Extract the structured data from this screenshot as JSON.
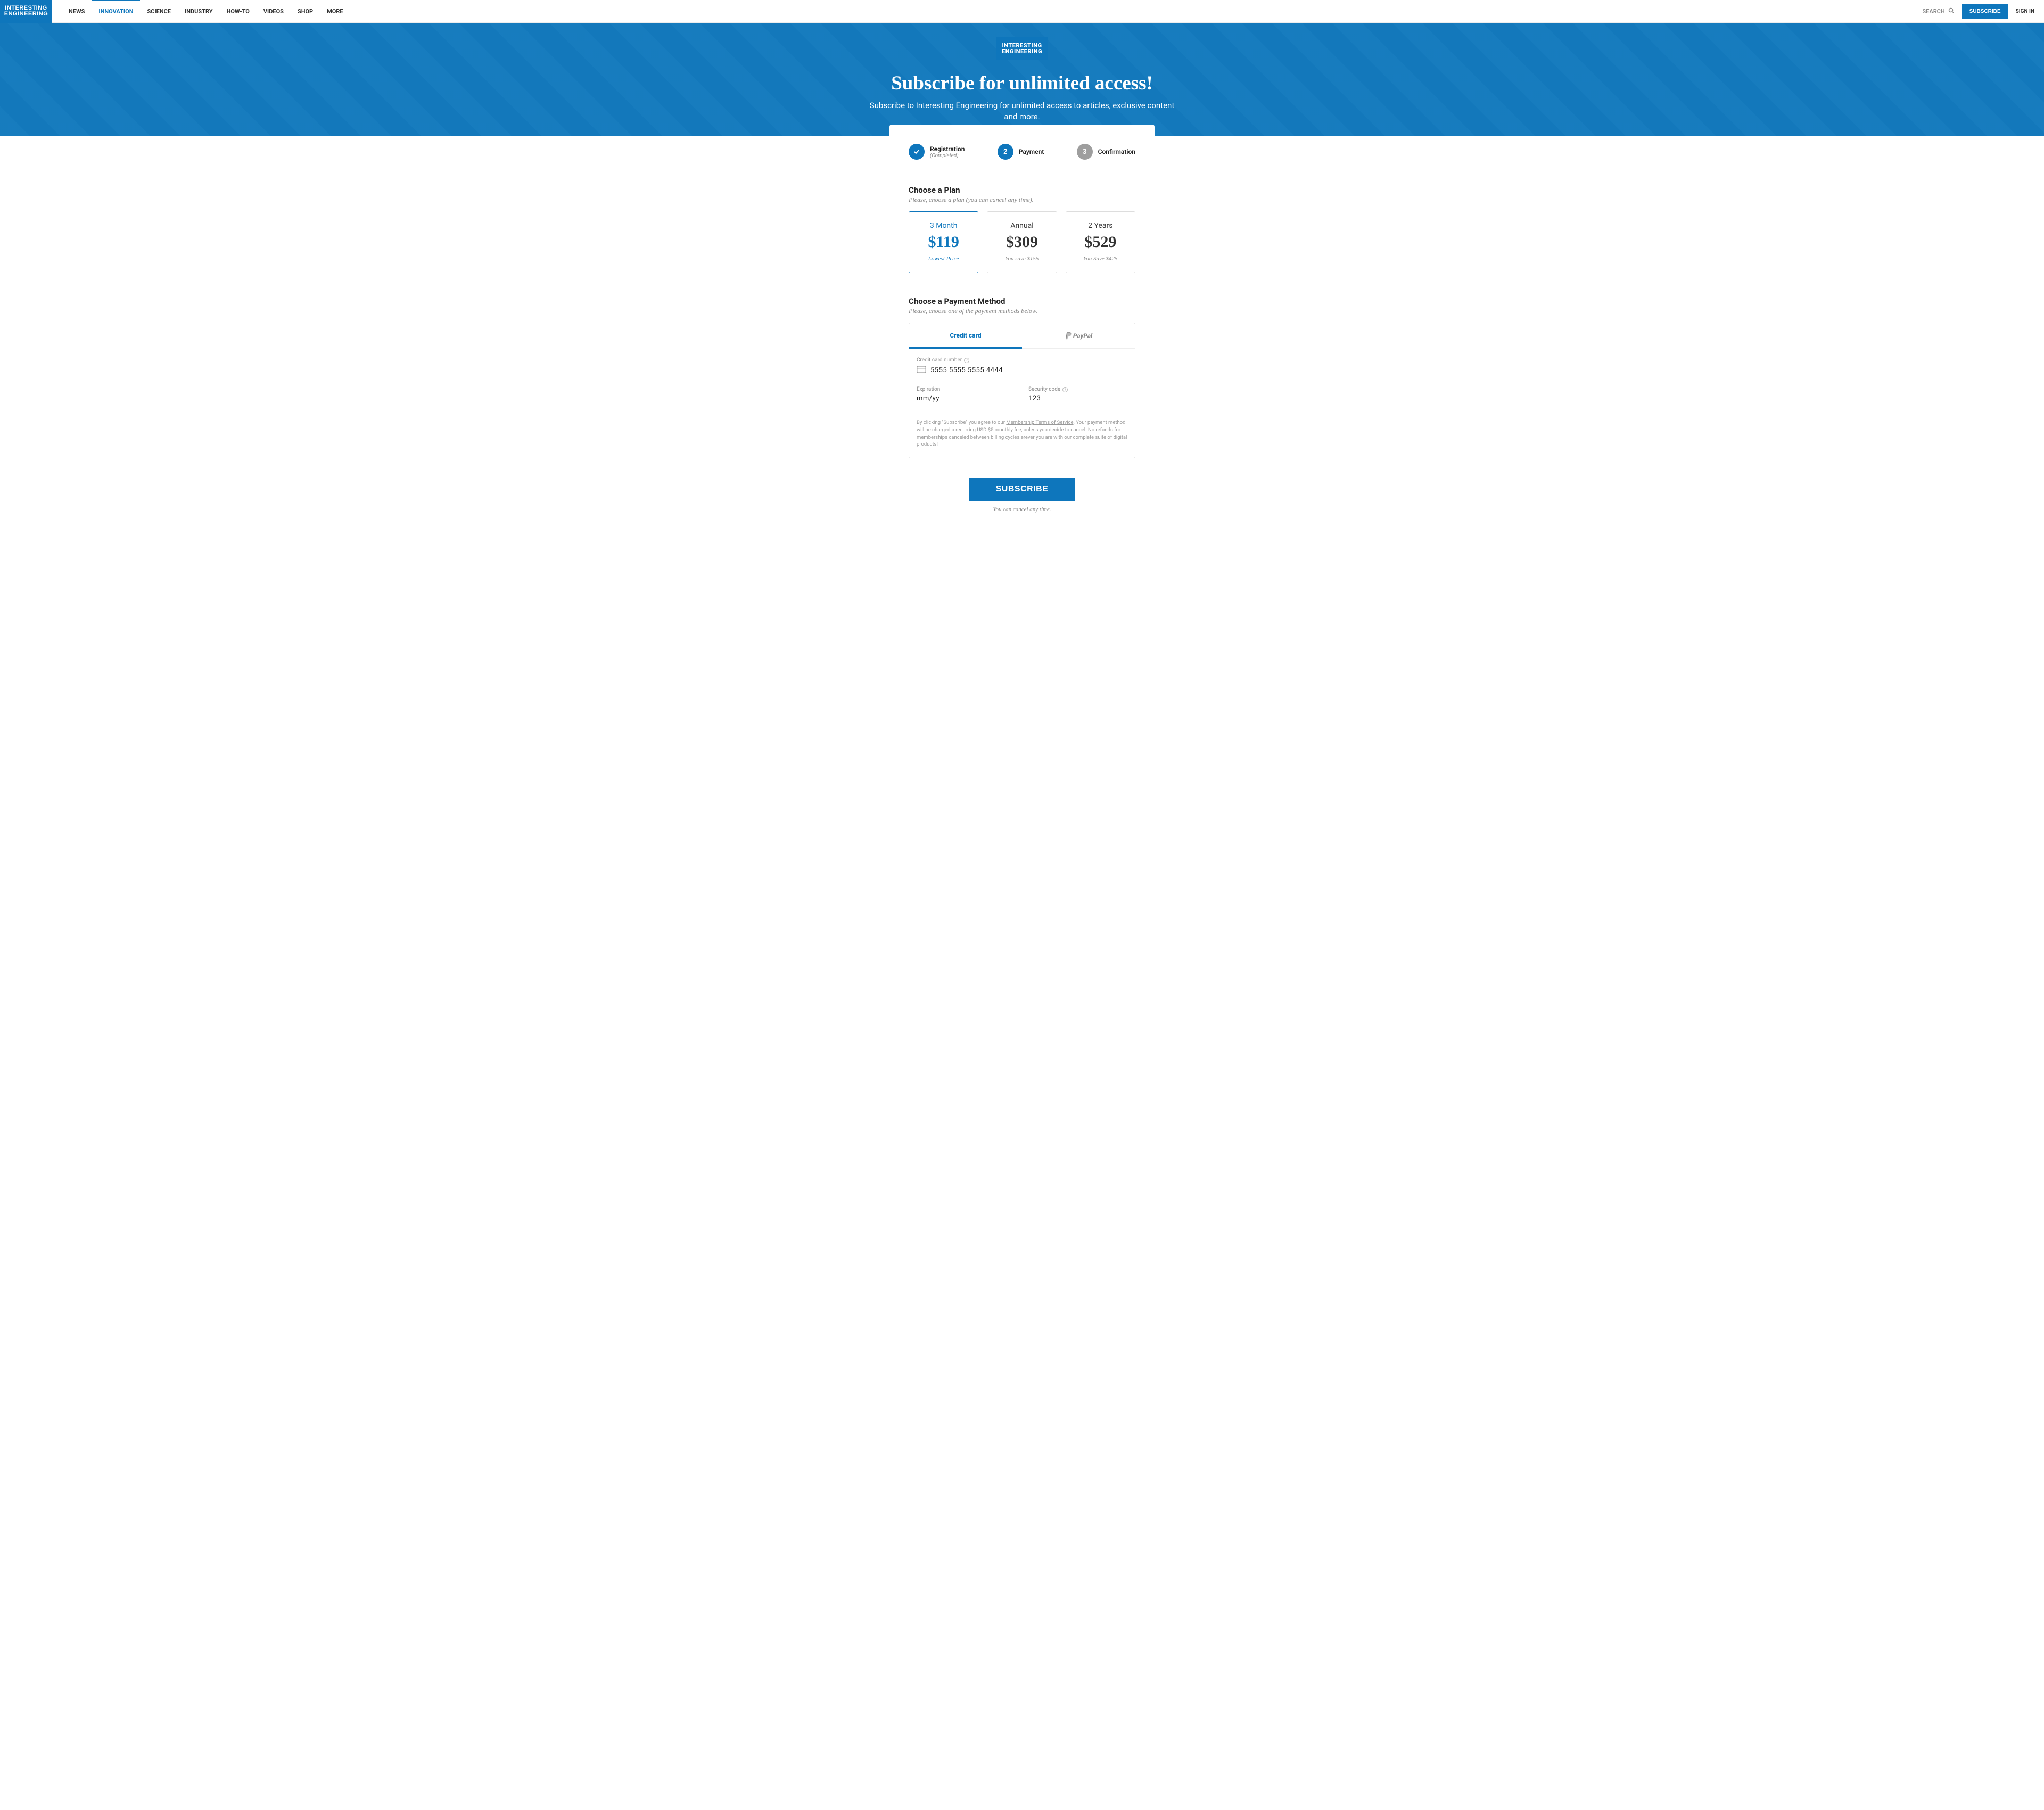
{
  "brand": {
    "line1": "INTERESTING",
    "line2": "ENGINEERING"
  },
  "nav": {
    "items": [
      "NEWS",
      "INNOVATION",
      "SCIENCE",
      "INDUSTRY",
      "HOW-TO",
      "VIDEOS",
      "SHOP",
      "MORE"
    ],
    "active_index": 1
  },
  "header": {
    "search_placeholder": "SEARCH",
    "subscribe": "SUBSCRIBE",
    "signin": "SIGN IN"
  },
  "hero": {
    "title": "Subscribe for unlimited access!",
    "subtitle": "Subscribe to Interesting Engineering for unlimited access to articles, exclusive content and more."
  },
  "stepper": {
    "steps": [
      {
        "label": "Registration",
        "sub": "(Completed)",
        "state": "done"
      },
      {
        "label": "Payment",
        "state": "active",
        "num": "2"
      },
      {
        "label": "Confirmation",
        "state": "pending",
        "num": "3"
      }
    ]
  },
  "plan_section": {
    "title": "Choose a Plan",
    "sub": "Please, choose a plan (you can cancel any time).",
    "plans": [
      {
        "name": "3 Month",
        "price": "$119",
        "note": "Lowest Price",
        "selected": true
      },
      {
        "name": "Annual",
        "price": "$309",
        "note": "You save $155",
        "selected": false
      },
      {
        "name": "2 Years",
        "price": "$529",
        "note": "You Save $425",
        "selected": false
      }
    ]
  },
  "payment_section": {
    "title": "Choose a Payment Method",
    "sub": "Please, choose one of the payment methods below.",
    "tabs": {
      "credit": "Credit card",
      "paypal": "PayPal"
    },
    "fields": {
      "card_label": "Credit card number",
      "card_value": "5555  5555  5555  4444",
      "exp_label": "Expiration",
      "exp_placeholder": "mm/yy",
      "cvc_label": "Security code",
      "cvc_placeholder": "123"
    },
    "disclaimer_pre": "By clicking \"Subscribe\" you agree to our ",
    "disclaimer_link": "Membership Terms of Service",
    "disclaimer_post": ". Your payment method will be charged a recurring USD $5 monthly fee, unless you decide to cancel. No refunds for memberships canceled between billing cycles.erever you are with our complete suite of digital products!"
  },
  "submit": {
    "button": "SUBSCRIBE",
    "note": "You can cancel any time."
  }
}
